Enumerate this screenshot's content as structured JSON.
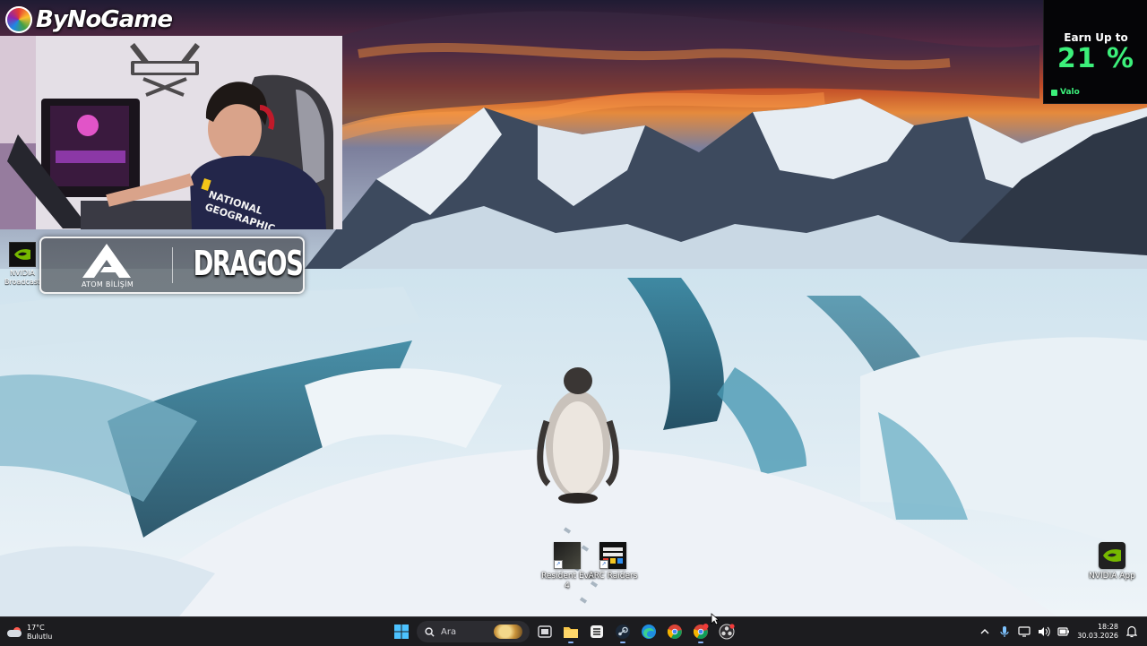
{
  "stream_branding": {
    "channel_logo_text": "ByNoGame"
  },
  "sponsors": {
    "nvidia_badge_label": "NVIDIA Broadcast",
    "atom_label": "ATOM BİLİŞİM",
    "dragos_label": "DRAGOS"
  },
  "promo": {
    "headline": "Earn Up to",
    "value": "21 %",
    "brand": "Valo",
    "accent_color": "#3cf07a"
  },
  "desktop_icons": [
    {
      "label": "Resident Evil 4",
      "icon": "resident-evil-4-icon"
    },
    {
      "label": "ARC Raiders",
      "icon": "arc-raiders-icon"
    },
    {
      "label": "NVIDIA App",
      "icon": "nvidia-app-icon"
    }
  ],
  "taskbar": {
    "weather": {
      "temperature": "17°C",
      "condition": "Bulutlu"
    },
    "search_placeholder": "Ara",
    "pinned_apps": [
      "start-icon",
      "search-icon",
      "task-view-icon",
      "file-explorer-icon",
      "snipping-tool-icon",
      "steam-icon",
      "edge-icon",
      "chrome-icon",
      "chrome-profile-icon",
      "obs-icon"
    ],
    "clock": {
      "time": "18:28",
      "date": "30.03.2026"
    }
  }
}
